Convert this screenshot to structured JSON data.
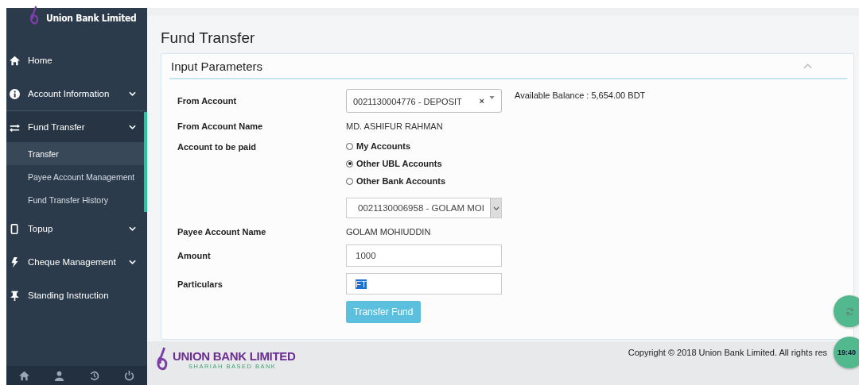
{
  "sidebar": {
    "logo_text": "Union Bank Limited",
    "items": [
      {
        "label": "Home",
        "has_submenu": false,
        "expanded": false
      },
      {
        "label": "Account Information",
        "has_submenu": true,
        "expanded": false
      },
      {
        "label": "Fund Transfer",
        "has_submenu": true,
        "expanded": true,
        "children": [
          {
            "label": "Transfer",
            "selected": true
          },
          {
            "label": "Payee Account Management",
            "selected": false
          },
          {
            "label": "Fund Transfer History",
            "selected": false
          }
        ]
      },
      {
        "label": "Topup",
        "has_submenu": true,
        "expanded": false
      },
      {
        "label": "Cheque Management",
        "has_submenu": true,
        "expanded": false
      },
      {
        "label": "Standing Instruction",
        "has_submenu": false,
        "expanded": false
      }
    ]
  },
  "page_title": "Fund Transfer",
  "panel": {
    "title": "Input Parameters",
    "from_account": {
      "label": "From Account",
      "value": "0021130004776 - DEPOSIT",
      "clear": "×"
    },
    "available_balance": "Available Balance : 5,654.00 BDT",
    "from_account_name": {
      "label": "From Account Name",
      "value": "MD. ASHIFUR RAHMAN"
    },
    "account_to_be_paid": {
      "label": "Account to be paid",
      "options": [
        {
          "label": "My Accounts",
          "selected": false
        },
        {
          "label": "Other UBL Accounts",
          "selected": true
        },
        {
          "label": "Other Bank Accounts",
          "selected": false
        }
      ]
    },
    "payee_account": {
      "value": "0021130006958 - GOLAM MOI"
    },
    "payee_account_name": {
      "label": "Payee Account Name",
      "value": "GOLAM MOHIUDDIN"
    },
    "amount": {
      "label": "Amount",
      "value": "1000"
    },
    "particulars": {
      "label": "Particulars",
      "value": "FT",
      "text_selected": true
    },
    "submit": "Transfer Fund"
  },
  "footer": {
    "logo_text": "UNION BANK LIMITED",
    "tagline": "SHARIAH BASED BANK",
    "copyright": "Copyright © 2018 Union Bank Limited. All rights res"
  },
  "floating_buttons": [
    {
      "kind": "refresh"
    },
    {
      "kind": "clock",
      "text": "19:40"
    }
  ]
}
